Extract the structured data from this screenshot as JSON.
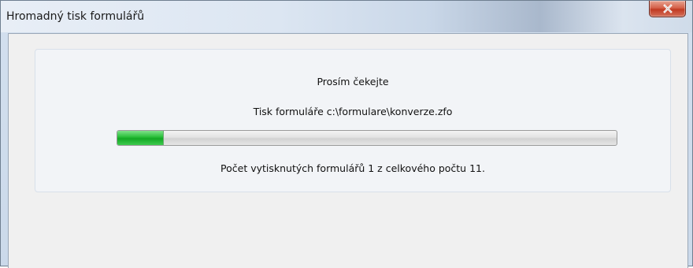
{
  "window": {
    "title": "Hromadný tisk formulářů",
    "close_icon": "close-icon"
  },
  "dialog": {
    "wait_message": "Prosím čekejte",
    "printing_message": "Tisk formuláře c:\\formulare\\konverze.zfo",
    "count_message": "Počet vytisknutých formulářů 1 z celkového počtu 11."
  },
  "progress": {
    "printed": 1,
    "total": 11,
    "fraction": 0.0909
  },
  "colors": {
    "progress_fill": "#1fb530",
    "close_button": "#c9452d",
    "titlebar": "#dce6f2"
  }
}
